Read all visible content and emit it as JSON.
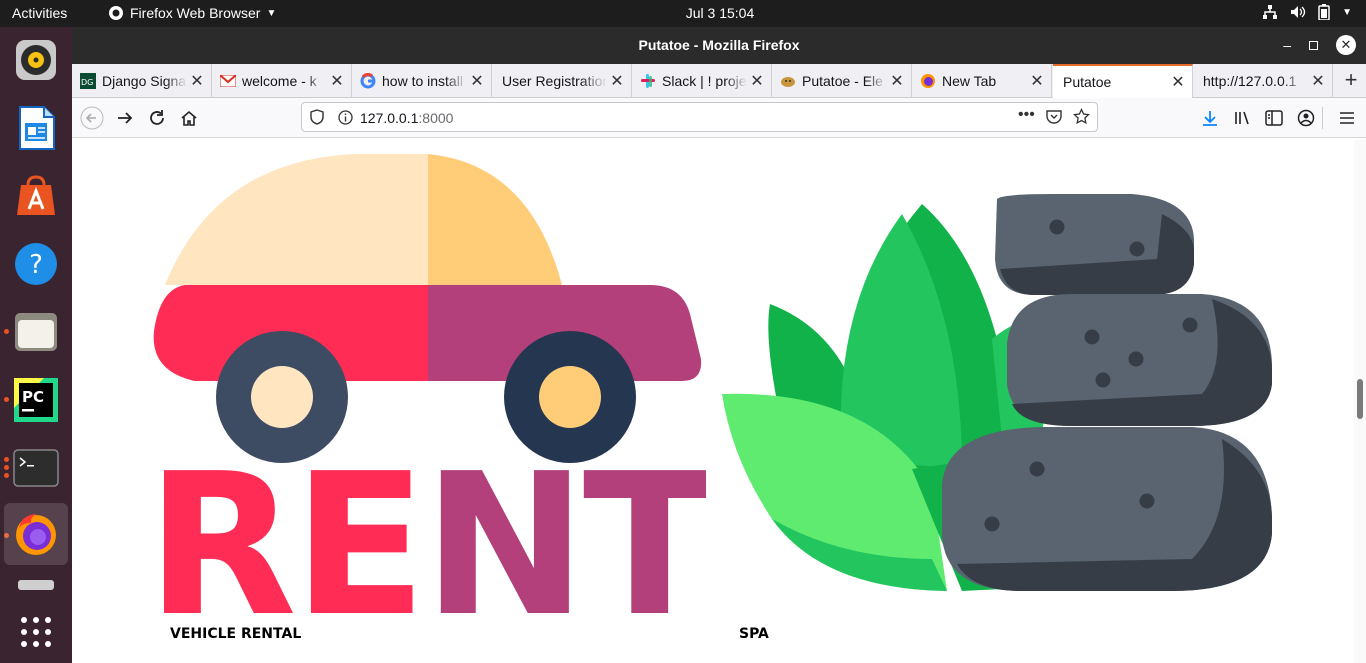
{
  "topbar": {
    "activities": "Activities",
    "app_menu": "Firefox Web Browser",
    "clock": "Jul 3  15:04"
  },
  "window": {
    "title": "Putatoe - Mozilla Firefox"
  },
  "tabs": [
    {
      "label": "Django Signals",
      "favicon": "django-icon"
    },
    {
      "label": "welcome - k",
      "favicon": "gmail-icon"
    },
    {
      "label": "how to install",
      "favicon": "google-icon"
    },
    {
      "label": "User Registration",
      "favicon": "none"
    },
    {
      "label": "Slack | ! project",
      "favicon": "slack-icon"
    },
    {
      "label": "Putatoe - Ele",
      "favicon": "putatoe-icon"
    },
    {
      "label": "New Tab",
      "favicon": "firefox-icon"
    },
    {
      "label": "Putatoe",
      "favicon": "none",
      "selected": true
    },
    {
      "label": "http://127.0.0.1",
      "favicon": "none"
    }
  ],
  "urlbar": {
    "host": "127.0.0.1",
    "port": ":8000"
  },
  "page": {
    "cards": [
      {
        "label": "VEHICLE RENTAL",
        "image_text": "RENT"
      },
      {
        "label": "SPA"
      }
    ]
  },
  "colors": {
    "dock_bg": "#3a2430",
    "accent": "#e66c2c",
    "rent_red": "#ff2d55",
    "rent_magenta": "#b3407a",
    "stone": "#596470",
    "stone_dark": "#363d46",
    "leaf": "#22c55e"
  }
}
